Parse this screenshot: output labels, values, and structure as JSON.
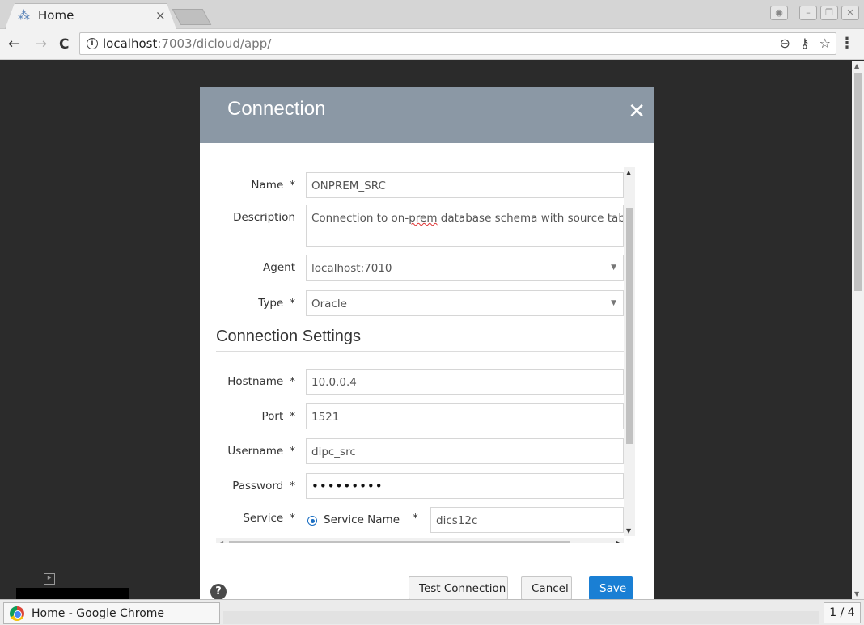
{
  "browser": {
    "tab_title": "Home",
    "tab_close": "×",
    "url_host": "localhost",
    "url_rest": ":7003/dicloud/app/",
    "info_glyph": "i"
  },
  "dialog": {
    "title": "Connection",
    "close_glyph": "✕",
    "fields": {
      "name_label": "Name",
      "name_value": "ONPREM_SRC",
      "description_label": "Description",
      "description_pre": "Connection to on-",
      "description_misspelled": "prem",
      "description_post": " database schema with source tables",
      "agent_label": "Agent",
      "agent_value": "localhost:7010",
      "type_label": "Type",
      "type_value": "Oracle"
    },
    "section_title": "Connection Settings",
    "settings": {
      "hostname_label": "Hostname",
      "hostname_value": "10.0.0.4",
      "port_label": "Port",
      "port_value": "1521",
      "username_label": "Username",
      "username_value": "dipc_src",
      "password_label": "Password",
      "password_value": "•••••••••",
      "service_label": "Service",
      "service_option": "Service Name",
      "service_value": "dics12c"
    },
    "required_mark": "*",
    "buttons": {
      "help": "?",
      "test": "Test Connection",
      "cancel": "Cancel",
      "save": "Save"
    }
  },
  "taskbar": {
    "window_label": "Home - Google Chrome",
    "pager": "1 / 4"
  },
  "colors": {
    "dialog_header": "#8b98a5",
    "primary_button": "#1a7fd4",
    "page_background": "#2b2b2b"
  }
}
